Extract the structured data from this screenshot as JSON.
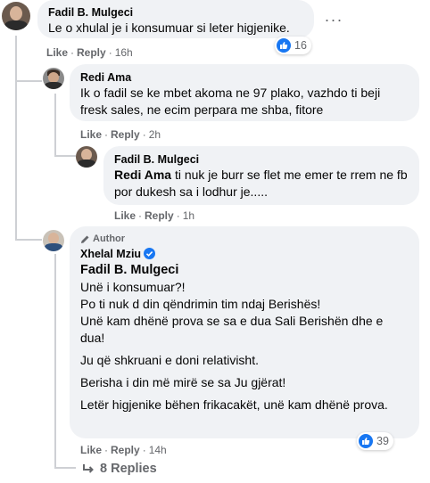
{
  "comments": [
    {
      "author": "Fadil B. Mulgeci",
      "text": "Le o xhulal je i konsumuar si leter higjenike.",
      "like_label": "Like",
      "reply_label": "Reply",
      "time": "16h",
      "reaction_count": "16",
      "more_icon": "more-horizontal-icon"
    },
    {
      "author": "Redi Ama",
      "text": "Ik o fadil se ke mbet akoma ne 97 plako, vazhdo ti beji fresk sales, ne ecim perpara me shba, fitore",
      "like_label": "Like",
      "reply_label": "Reply",
      "time": "2h"
    },
    {
      "author": "Fadil B. Mulgeci",
      "mention": "Redi Ama",
      "text": " ti nuk je burr se flet me emer te rrem ne fb por dukesh sa i lodhur je.....",
      "like_label": "Like",
      "reply_label": "Reply",
      "time": "1h"
    },
    {
      "badge": "Author",
      "author": "Xhelal Mziu",
      "mention": "Fadil B. Mulgeci",
      "paragraphs": [
        "Unë i konsumuar?!",
        "Po ti nuk d din qëndrimin tim ndaj Berishës!",
        "Unë kam dhënë prova se sa e dua Sali Berishën dhe e dua!",
        "Ju që shkruani e doni relativisht.",
        "Berisha i din më mirë se sa Ju gjërat!",
        "Letër higjenike bëhen frikacakët, unë kam dhënë prova."
      ],
      "like_label": "Like",
      "reply_label": "Reply",
      "time": "14h",
      "reaction_count": "39"
    }
  ],
  "replies_link": "8 Replies",
  "colors": {
    "bubble": "#f0f2f5",
    "meta": "#65676b",
    "accent": "#1877f2"
  }
}
